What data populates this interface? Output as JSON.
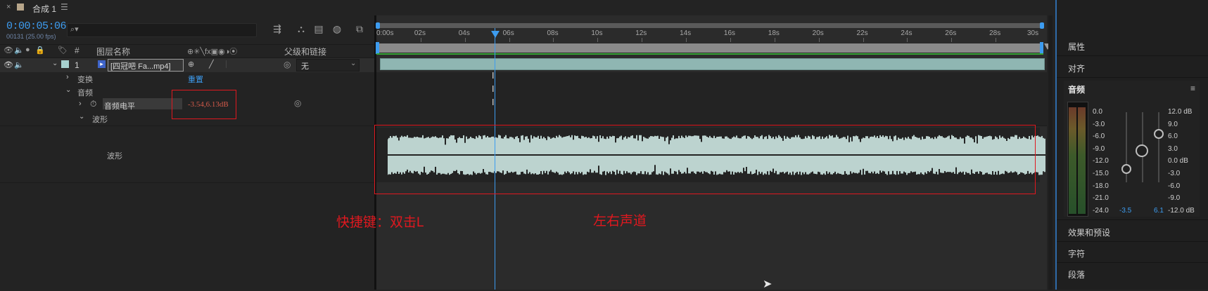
{
  "comp_tab": {
    "close": "×",
    "title": "合成 1",
    "menu": "☰"
  },
  "time": {
    "timecode": "0:00:05:06",
    "frames_fps": "00131 (25.00 fps)"
  },
  "search": {
    "icon": "⌕▾"
  },
  "columns": {
    "layer_name": "图层名称",
    "hash": "#",
    "parent": "父级和链接",
    "switch_icons": "⊕✳╲fx▣◉◑⦿"
  },
  "layer": {
    "number": "1",
    "name": "[四冠吧 Fa...mp4]",
    "label_color": "#a7d1cf",
    "parent_value": "无",
    "parent_chevron": "⌄",
    "spiral": "◎"
  },
  "properties": {
    "transform": "变换",
    "reset": "重置",
    "audio": "音频",
    "audio_levels": "音频电平",
    "audio_levels_value": "-3.54,6.13dB",
    "waveform_group": "波形",
    "waveform": "波形"
  },
  "ruler": {
    "ticks": [
      "0:00s",
      "02s",
      "04s",
      "06s",
      "08s",
      "10s",
      "12s",
      "14s",
      "16s",
      "18s",
      "20s",
      "22s",
      "24s",
      "26s",
      "28s",
      "30s"
    ]
  },
  "annotations": {
    "shortcut": "快捷键：双击L",
    "channels": "左右声道"
  },
  "right_panel": {
    "properties": "属性",
    "align": "对齐",
    "audio": "音频",
    "audio_menu": "≡",
    "effects": "效果和预设",
    "character": "字符",
    "paragraph": "段落"
  },
  "audio_meter": {
    "left_scale": [
      "0.0",
      "-3.0",
      "-6.0",
      "-9.0",
      "-12.0",
      "-15.0",
      "-18.0",
      "-21.0",
      "-24.0"
    ],
    "right_scale": [
      "12.0 dB",
      "9.0",
      "6.0",
      "3.0",
      "0.0 dB",
      "-3.0",
      "-6.0",
      "-9.0",
      "-12.0 dB"
    ],
    "left_value": "-3.5",
    "right_value": "6.1"
  }
}
